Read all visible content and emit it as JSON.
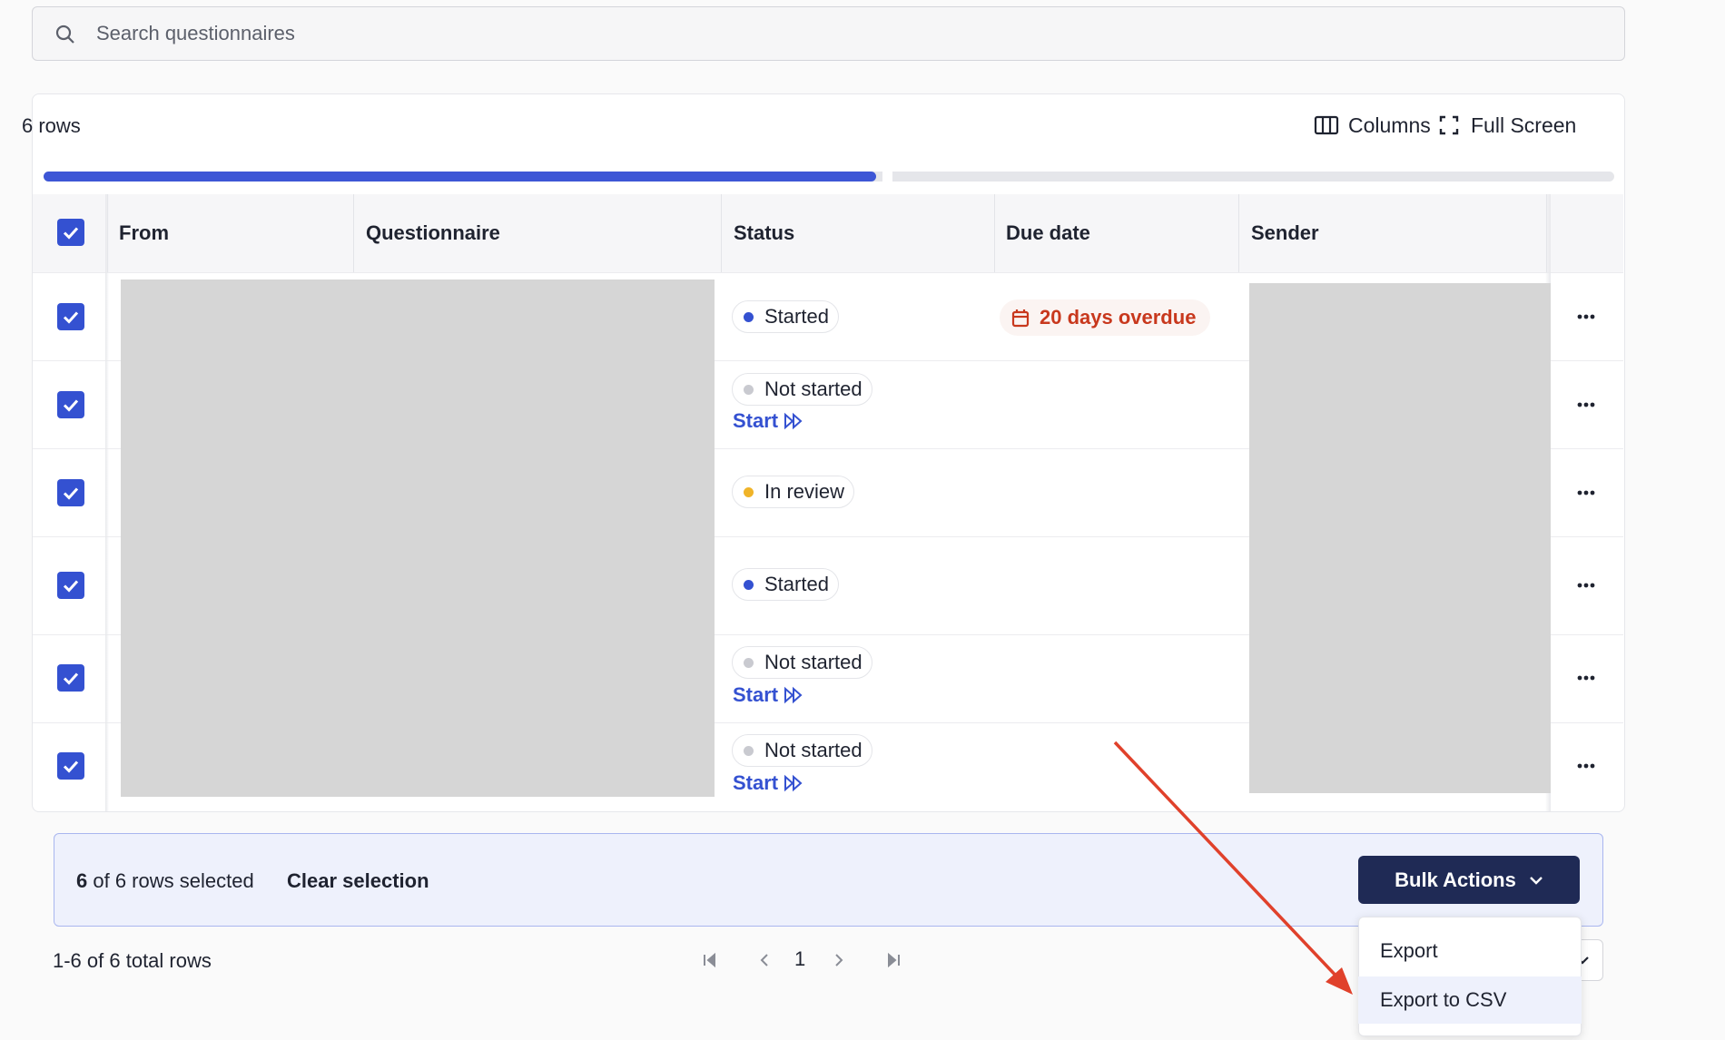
{
  "search": {
    "placeholder": "Search questionnaires"
  },
  "toolbar": {
    "row_count": "6 rows",
    "columns_label": "Columns",
    "fullscreen_label": "Full Screen"
  },
  "progress": {
    "fraction": 0.53
  },
  "table": {
    "columns": [
      "From",
      "Questionnaire",
      "Status",
      "Due date",
      "Sender"
    ],
    "rows": [
      {
        "status": "Started",
        "status_color": "#3451d1",
        "due": "20 days overdue",
        "action": ""
      },
      {
        "status": "Not started",
        "status_color": "#c9cad0",
        "due": "",
        "action": "Start"
      },
      {
        "status": "In review",
        "status_color": "#f0b429",
        "due": "",
        "action": ""
      },
      {
        "status": "Started",
        "status_color": "#3451d1",
        "due": "",
        "action": ""
      },
      {
        "status": "Not started",
        "status_color": "#c9cad0",
        "due": "",
        "action": "Start"
      },
      {
        "status": "Not started",
        "status_color": "#c9cad0",
        "due": "",
        "action": "Start"
      }
    ]
  },
  "selection": {
    "count": "6",
    "rest": "of 6 rows selected",
    "clear_label": "Clear selection",
    "bulk_label": "Bulk Actions"
  },
  "pagination": {
    "total": "1-6 of 6 total rows",
    "page": "1"
  },
  "menu": {
    "items": [
      "Export",
      "Export to CSV"
    ]
  },
  "colors": {
    "accent": "#3451d1",
    "primary_button": "#1f2a55",
    "overdue": "#c8381d",
    "annotation_arrow": "#e0412b"
  }
}
